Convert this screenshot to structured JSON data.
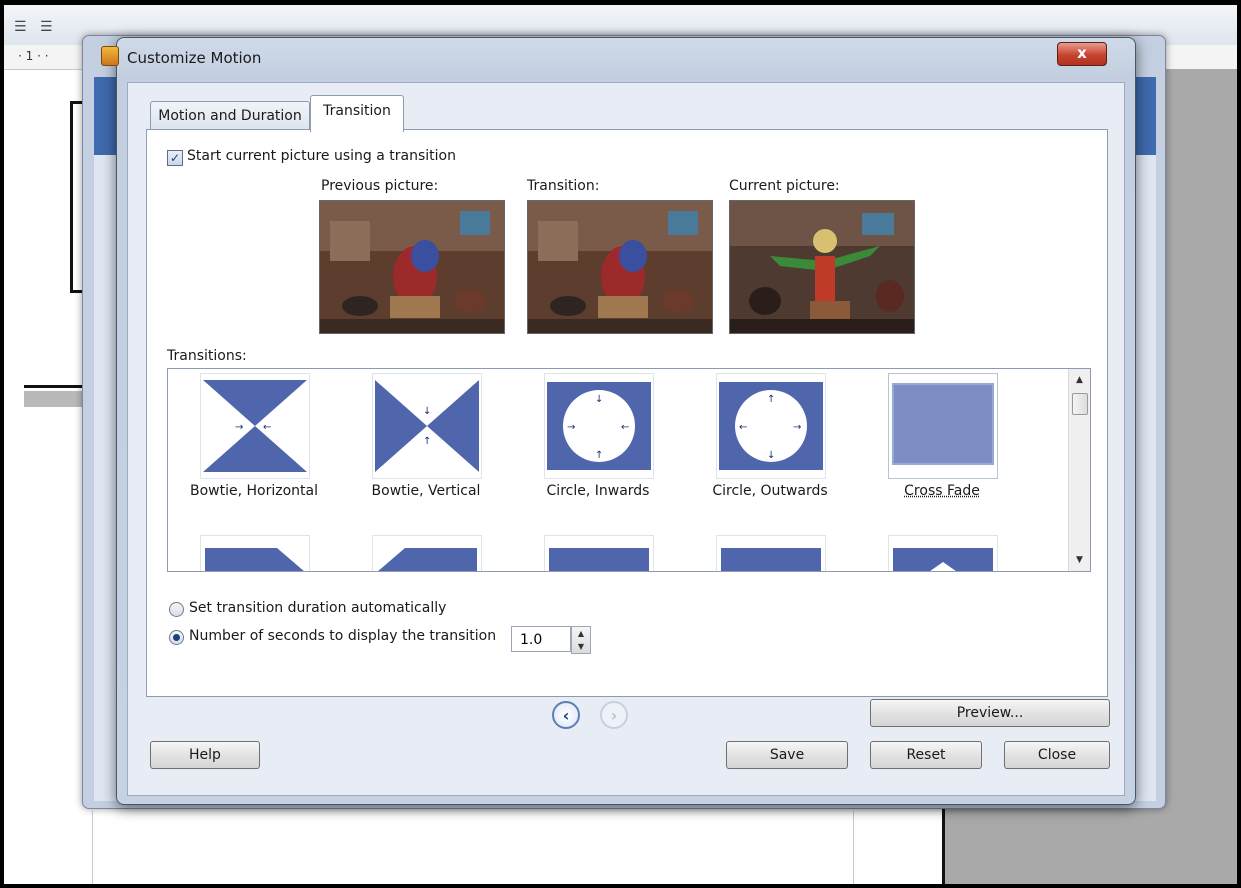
{
  "background_app": {
    "ruler_text": "· 1 · ·",
    "toolbar_icons": [
      "align-left-icon",
      "align-justify-icon"
    ]
  },
  "dialog": {
    "title": "Customize Motion",
    "close_label": "x",
    "tabs": [
      {
        "label": "Motion and Duration",
        "selected": false
      },
      {
        "label": "Transition",
        "selected": true
      }
    ],
    "start_transition": {
      "label": "Start current picture using a transition",
      "checked": true
    },
    "pictures": [
      {
        "label": "Previous picture:"
      },
      {
        "label": "Transition:"
      },
      {
        "label": "Current picture:"
      }
    ],
    "transitions_label": "Transitions:",
    "transitions": [
      {
        "name": "Bowtie, Horizontal",
        "icon": "bowtie-horizontal-icon"
      },
      {
        "name": "Bowtie, Vertical",
        "icon": "bowtie-vertical-icon"
      },
      {
        "name": "Circle, Inwards",
        "icon": "circle-inwards-icon"
      },
      {
        "name": "Circle, Outwards",
        "icon": "circle-outwards-icon"
      },
      {
        "name": "Cross Fade",
        "icon": "cross-fade-icon",
        "selected": true
      }
    ],
    "duration": {
      "auto_label": "Set transition duration automatically",
      "manual_label": "Number of seconds to display the transition",
      "selected": "manual",
      "seconds": "1.0"
    },
    "buttons": {
      "preview": "Preview...",
      "help": "Help",
      "save": "Save",
      "reset": "Reset",
      "close": "Close"
    },
    "nav": {
      "back": "‹",
      "forward": "›"
    },
    "colors": {
      "tile_blue": "#4f66ac",
      "cross_fade": "#7d8ec4",
      "close_red": "#c7432f"
    }
  }
}
